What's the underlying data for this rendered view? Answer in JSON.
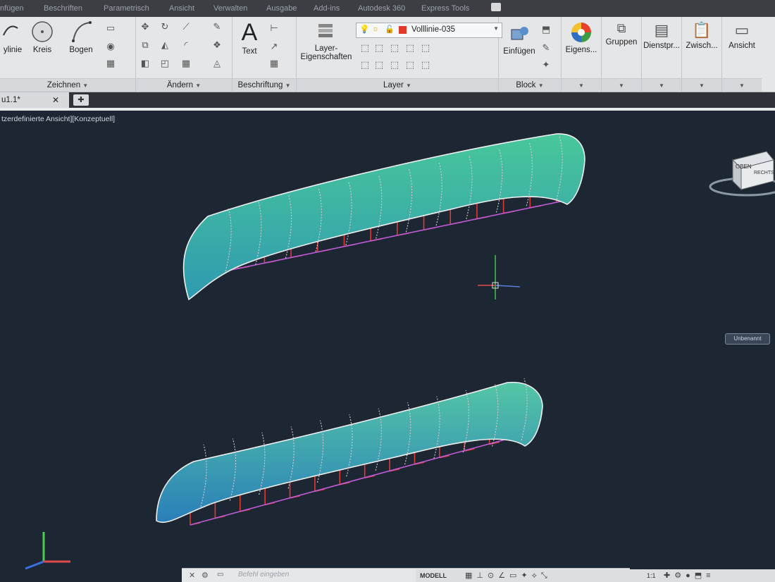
{
  "menubar": [
    "nfügen",
    "Beschriften",
    "Parametrisch",
    "Ansicht",
    "Verwalten",
    "Ausgabe",
    "Add-ins",
    "Autodesk 360",
    "Express Tools"
  ],
  "ribbon": {
    "zeichnen": {
      "title": "Zeichnen",
      "polylinie": "ylinie",
      "kreis": "Kreis",
      "bogen": "Bogen"
    },
    "aendern": {
      "title": "Ändern"
    },
    "beschriftung": {
      "title": "Beschriftung",
      "text": "Text"
    },
    "layer": {
      "title": "Layer",
      "props_line1": "Layer-",
      "props_line2": "Eigenschaften",
      "current": "Volllinie-035",
      "current_color": "#e23a2a"
    },
    "block": {
      "title": "Block",
      "insert": "Einfügen"
    },
    "eigenschaften": {
      "label": "Eigens..."
    },
    "gruppen": {
      "label": "Gruppen"
    },
    "dienstprogramme": {
      "label": "Dienstpr..."
    },
    "zwischenablage": {
      "label": "Zwisch..."
    },
    "ansicht": {
      "label": "Ansicht"
    }
  },
  "tabs": {
    "document": "u1.1*"
  },
  "viewport": {
    "label": "tzerdefinierte Ansicht][Konzeptuell]",
    "viewcube_top": "OBEN",
    "viewcube_right": "RECHTS",
    "wcs_menu": "Unbenannt"
  },
  "command": {
    "placeholder": "Befehl eingeben"
  },
  "status": {
    "model": "MODELL",
    "scale": "1:1"
  },
  "colors": {
    "hull_top": "#3cb98f",
    "hull_bottom": "#2f8bb8",
    "frames": "#e03a33",
    "keel": "#c05bd8"
  }
}
